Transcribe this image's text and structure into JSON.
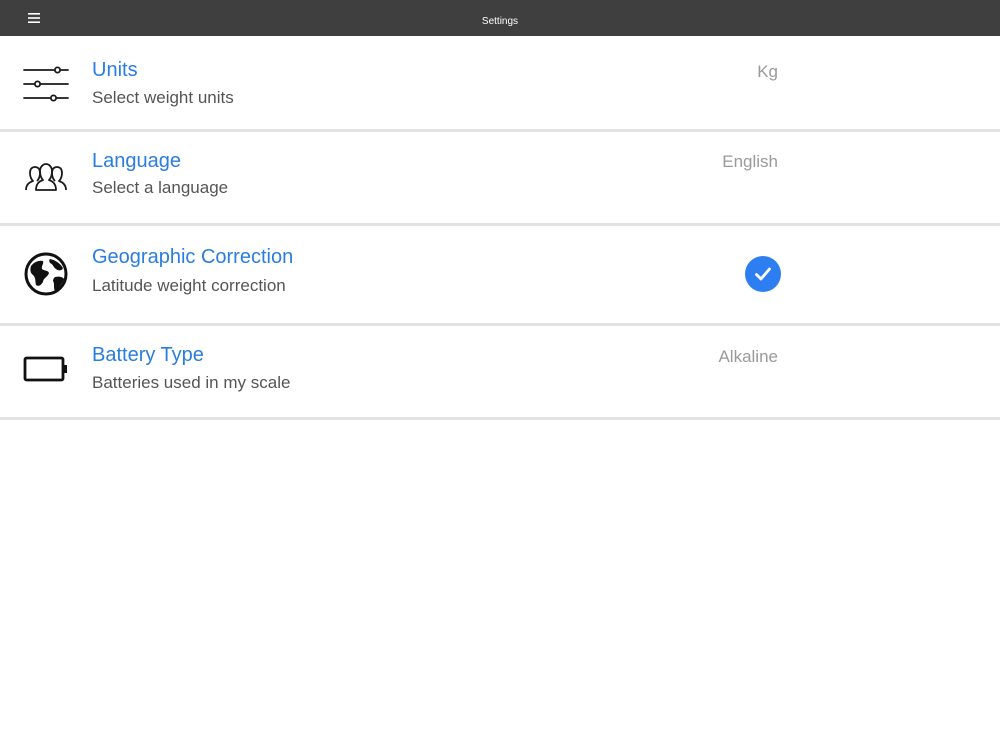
{
  "header": {
    "title": "Settings",
    "menu_icon": "hamburger-menu-icon"
  },
  "settings": [
    {
      "title": "Units",
      "subtitle": "Select weight units",
      "value": "Kg",
      "icon": "sliders-icon"
    },
    {
      "title": "Language",
      "subtitle": "Select a language",
      "value": "English",
      "icon": "people-icon"
    },
    {
      "title": "Geographic Correction",
      "subtitle": "Latitude weight correction",
      "checked": true,
      "icon": "globe-icon"
    },
    {
      "title": "Battery Type",
      "subtitle": "Batteries used in my scale",
      "value": "Alkaline",
      "icon": "battery-icon"
    }
  ],
  "colors": {
    "accent": "#2a7de1",
    "checkbox": "#2d7ef0",
    "topbar": "#3f3f3f",
    "divider": "#e2e2e2"
  }
}
